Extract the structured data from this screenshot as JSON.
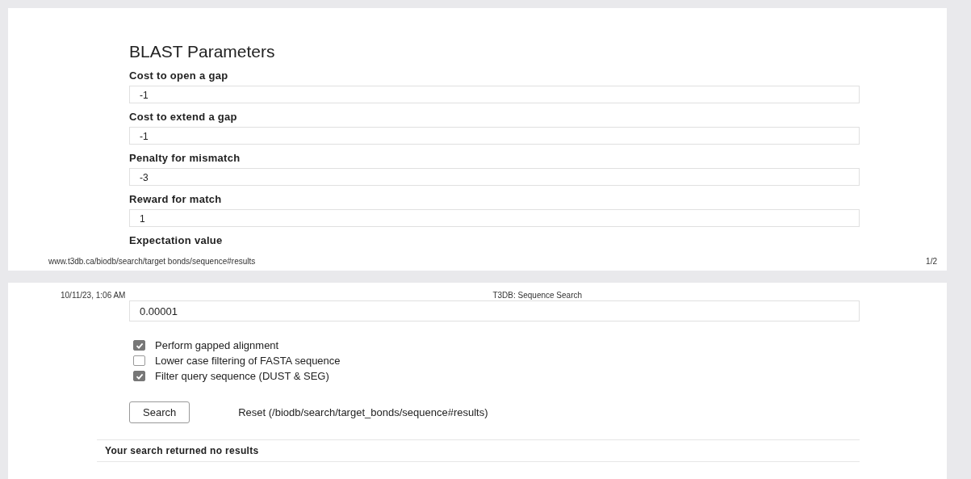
{
  "page_1": {
    "heading": "BLAST Parameters",
    "fields": [
      {
        "label": "Cost to open a gap",
        "value": "-1"
      },
      {
        "label": "Cost to extend a gap",
        "value": "-1"
      },
      {
        "label": "Penalty for mismatch",
        "value": "-3"
      },
      {
        "label": "Reward for match",
        "value": "1"
      }
    ],
    "last_label": "Expectation value",
    "footer_url": "www.t3db.ca/biodb/search/target  bonds/sequence#results",
    "page_number": "1/2"
  },
  "page_2": {
    "header_date": "10/11/23, 1:06 AM",
    "header_title": "T3DB: Sequence Search",
    "expectation_value": "0.00001",
    "options": [
      {
        "label": "Perform gapped alignment",
        "checked": true
      },
      {
        "label": "Lower case filtering of FASTA sequence",
        "checked": false
      },
      {
        "label": "Filter query sequence (DUST & SEG)",
        "checked": true
      }
    ],
    "search_button": "Search",
    "reset_link": "Reset (/biodb/search/target_bonds/sequence#results)",
    "result_message": "Your search returned no results"
  }
}
